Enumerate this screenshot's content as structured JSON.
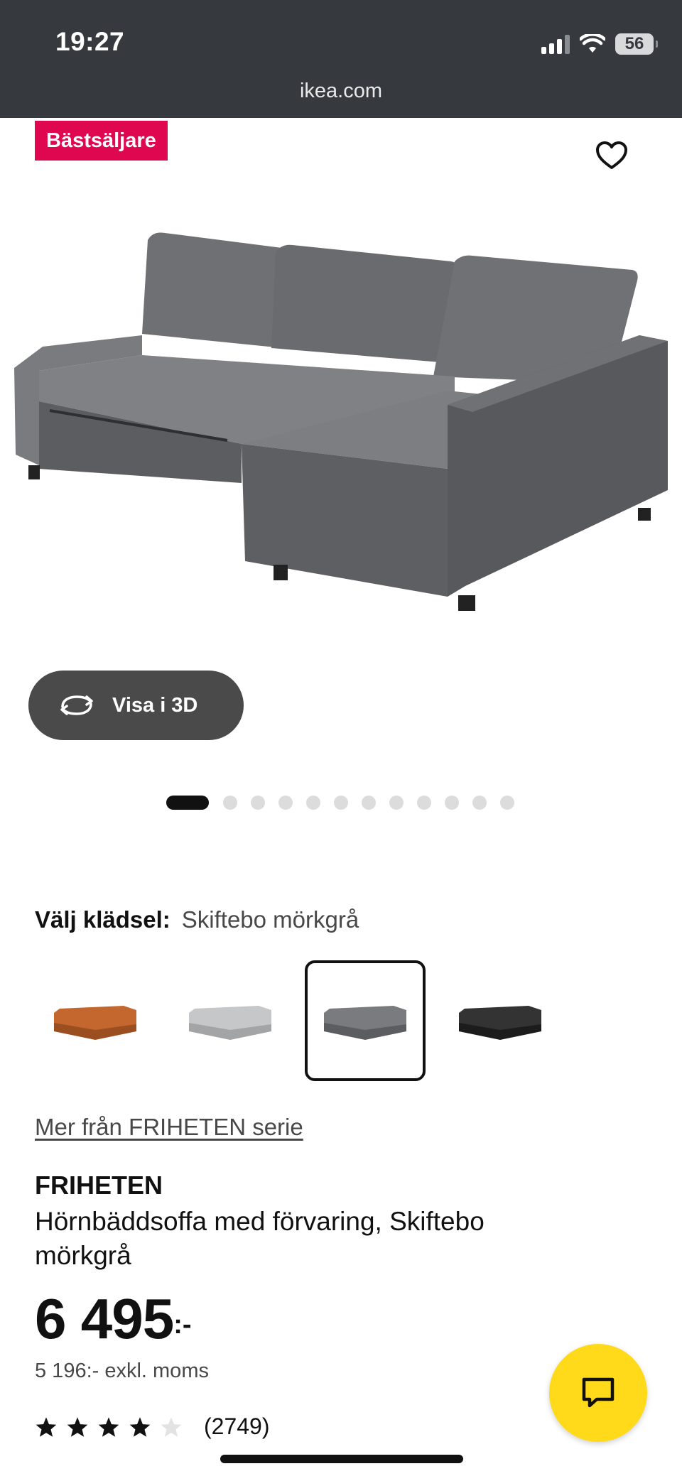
{
  "status_bar": {
    "time": "19:27",
    "battery": "56",
    "url": "ikea.com"
  },
  "product_image": {
    "badge": "Bästsäljare",
    "view_3d_label": "Visa i 3D",
    "carousel_total": 13,
    "carousel_active_index": 0
  },
  "upholstery": {
    "label": "Välj klädsel:",
    "value": "Skiftebo mörkgrå",
    "swatches": [
      {
        "name": "orange",
        "color": "#c4672e"
      },
      {
        "name": "light-grey",
        "color": "#b9babb"
      },
      {
        "name": "dark-grey",
        "color": "#6d6e71",
        "selected": true
      },
      {
        "name": "black",
        "color": "#2a2a2a"
      }
    ]
  },
  "product": {
    "more_link": "Mer från FRIHETEN serie",
    "name": "FRIHETEN",
    "description": "Hörnbäddsoffa med förvaring, Skiftebo mörkgrå",
    "price": "6 495",
    "price_suffix": ":-",
    "price_ex_vat": "5 196:- exkl. moms",
    "rating_value": 4,
    "rating_max": 5,
    "rating_count": "(2749)"
  },
  "colors": {
    "badge": "#e00751",
    "chat_button": "#ffda1a",
    "statusbar": "#36393d"
  },
  "icons": {
    "favorite": "heart-icon",
    "view_3d": "rotate-3d-icon",
    "chat": "chat-bubble-icon",
    "star": "star-icon"
  }
}
